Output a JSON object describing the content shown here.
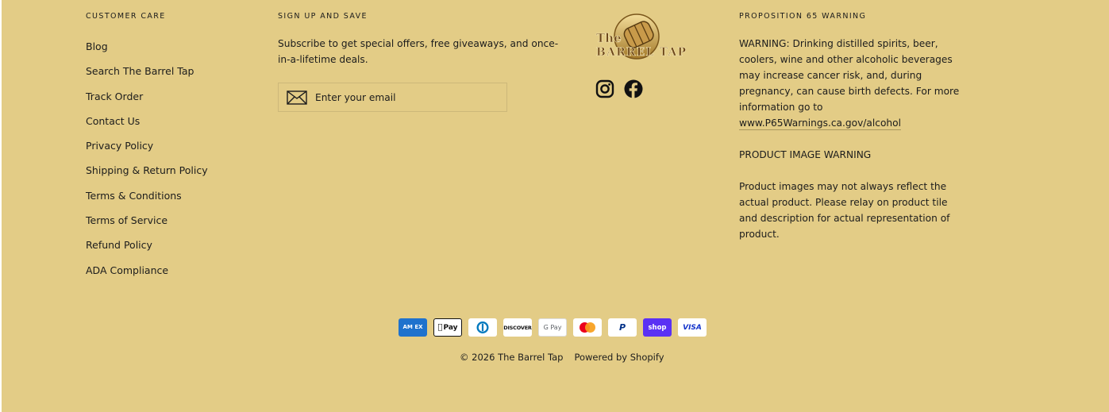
{
  "customer_care": {
    "heading": "CUSTOMER CARE",
    "links": [
      "Blog",
      "Search The Barrel Tap",
      "Track Order",
      "Contact Us",
      "Privacy Policy",
      "Shipping & Return Policy",
      "Terms & Conditions",
      "Terms of Service",
      "Refund Policy",
      "ADA Compliance"
    ]
  },
  "signup": {
    "heading": "SIGN UP AND SAVE",
    "text": "Subscribe to get special offers, free giveaways, and once-in-a-lifetime deals.",
    "email_placeholder": "Enter your email",
    "icon": "envelope-icon"
  },
  "brand": {
    "logo_text_top": "The",
    "logo_text_bottom": "BARREL TAP",
    "social": [
      "instagram-icon",
      "facebook-icon"
    ]
  },
  "prop65": {
    "heading": "PROPOSITION 65 WARNING",
    "warning_text": "WARNING: Drinking distilled spirits, beer, coolers, wine and other alcoholic beverages may increase cancer risk, and, during pregnancy, can cause birth defects. For more information go to",
    "warning_link": "www.P65Warnings.ca.gov/alcohol",
    "image_heading": "PRODUCT IMAGE WARNING",
    "image_text": "Product images may not always reflect the actual product. Please relay on product tile and description for actual representation of product."
  },
  "payments": {
    "amex": "AM EX",
    "apple": "Pay",
    "diners": "D",
    "discover": "DISCOVER",
    "google": "G Pay",
    "paypal": "P",
    "shop": "shop",
    "visa": "VISA"
  },
  "footer": {
    "copyright": "© 2026 The Barrel Tap",
    "powered": "Powered by Shopify"
  },
  "colors": {
    "background": "#e3cc86",
    "text": "#1c1c1c",
    "shop_pay": "#5a31f4",
    "amex": "#1f72cd"
  }
}
